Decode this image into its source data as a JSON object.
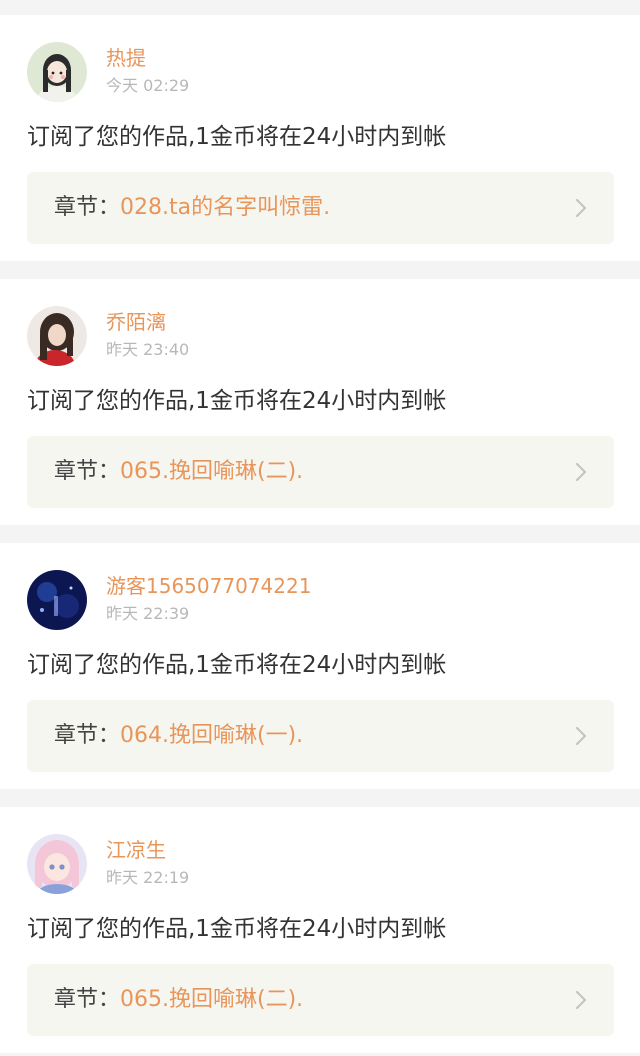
{
  "notifications": [
    {
      "username": "热提",
      "time": "今天 02:29",
      "message": "订阅了您的作品,1金币将在24小时内到帐",
      "chapter_label": "章节：",
      "chapter_title": "028.ta的名字叫惊雷.",
      "avatar_icon": "girl-avatar-icon"
    },
    {
      "username": "乔陌漓",
      "time": "昨天 23:40",
      "message": "订阅了您的作品,1金币将在24小时内到帐",
      "chapter_label": "章节：",
      "chapter_title": "065.挽回喻琳(二).",
      "avatar_icon": "photo-avatar-icon"
    },
    {
      "username": "游客1565077074221",
      "time": "昨天 22:39",
      "message": "订阅了您的作品,1金币将在24小时内到帐",
      "chapter_label": "章节：",
      "chapter_title": "064.挽回喻琳(一).",
      "avatar_icon": "night-avatar-icon"
    },
    {
      "username": "江凉生",
      "time": "昨天 22:19",
      "message": "订阅了您的作品,1金币将在24小时内到帐",
      "chapter_label": "章节：",
      "chapter_title": "065.挽回喻琳(二).",
      "avatar_icon": "anime-avatar-icon"
    }
  ],
  "colors": {
    "accent": "#e8955a",
    "page_background": "#f4f4f4",
    "chapter_background": "#f6f6f1"
  }
}
